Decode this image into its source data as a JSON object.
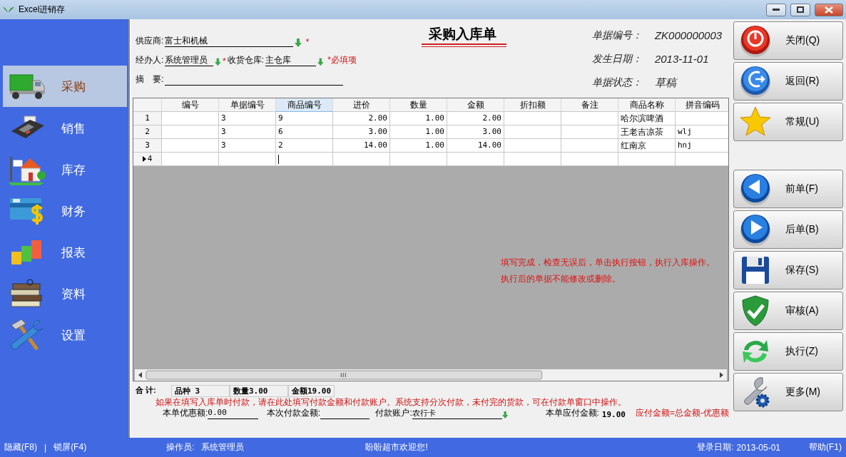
{
  "window": {
    "title": "Excel进销存"
  },
  "sidebar": {
    "items": [
      {
        "label": "采购",
        "selected": true,
        "kind": "truck"
      },
      {
        "label": "销售",
        "selected": false,
        "kind": "terminal"
      },
      {
        "label": "库存",
        "selected": false,
        "kind": "house"
      },
      {
        "label": "财务",
        "selected": false,
        "kind": "card"
      },
      {
        "label": "报表",
        "selected": false,
        "kind": "blocks"
      },
      {
        "label": "资料",
        "selected": false,
        "kind": "books"
      },
      {
        "label": "设置",
        "selected": false,
        "kind": "tools"
      }
    ]
  },
  "header": {
    "title": "采购入库单",
    "supplier": {
      "label": "供应商:",
      "value": "富士和机械",
      "required_mark": "*"
    },
    "handler": {
      "label": "经办人:",
      "value": "系统管理员",
      "required_mark": "*"
    },
    "warehouse": {
      "label": "收货仓库:",
      "value": "主仓库",
      "required_note": "*必填项"
    },
    "summary": {
      "label": "摘　要:"
    },
    "info": [
      {
        "label": "单据编号：",
        "value": "ZK000000003"
      },
      {
        "label": "发生日期：",
        "value": "2013-11-01"
      },
      {
        "label": "单据状态：",
        "value": "草稿"
      }
    ]
  },
  "table": {
    "columns": [
      {
        "label": "编号",
        "selected": false,
        "kind": "text"
      },
      {
        "label": "单据编号",
        "selected": false,
        "kind": "text"
      },
      {
        "label": "商品编号",
        "selected": true,
        "kind": "text"
      },
      {
        "label": "进价",
        "selected": false,
        "kind": "number"
      },
      {
        "label": "数量",
        "selected": false,
        "kind": "number"
      },
      {
        "label": "金额",
        "selected": false,
        "kind": "number"
      },
      {
        "label": "折扣额",
        "selected": false,
        "kind": "number"
      },
      {
        "label": "备注",
        "selected": false,
        "kind": "text"
      },
      {
        "label": "商品名称",
        "selected": false,
        "kind": "text"
      },
      {
        "label": "拼音编码",
        "selected": false,
        "kind": "text"
      }
    ],
    "rows": [
      {
        "number": "1",
        "current": false,
        "cells": [
          null,
          "3",
          "9",
          "2.00",
          "1.00",
          "2.00",
          null,
          null,
          "哈尔滨啤酒",
          null
        ]
      },
      {
        "number": "2",
        "current": false,
        "cells": [
          null,
          "3",
          "6",
          "3.00",
          "1.00",
          "3.00",
          null,
          null,
          "王老吉凉茶",
          "wlj"
        ]
      },
      {
        "number": "3",
        "current": false,
        "cells": [
          null,
          "3",
          "2",
          "14.00",
          "1.00",
          "14.00",
          null,
          null,
          "红南京",
          "hnj"
        ]
      },
      {
        "number": "4",
        "current": true
      }
    ]
  },
  "instructions": [
    "填写完成，检查无误后，单击执行按钮，执行入库操作。",
    "执行后的单据不能修改或删除。"
  ],
  "totals": {
    "label": "合 计:",
    "items": [
      "品种 3",
      "数量3.00",
      "金额19.00"
    ]
  },
  "payment_note": "如果在填写入库单时付款，请在此处填写付款金额和付款账户。系统支持分次付款，未付完的货款，可在付款单窗口中操作。",
  "payment": {
    "discount": {
      "label": "本单优惠额:",
      "value": "0.00"
    },
    "paid": {
      "label": "本次付款金额:"
    },
    "account": {
      "label": "付款账户:",
      "value": "农行卡"
    },
    "payable": {
      "label": "本单应付金额:",
      "value": "19.00"
    },
    "formula": "应付金额=总金额-优惠额"
  },
  "actions": {
    "primary": [
      {
        "label": "关闭(Q)",
        "kind": "power"
      },
      {
        "label": "返回(R)",
        "kind": "back"
      },
      {
        "label": "常规(U)",
        "kind": "star"
      }
    ],
    "navigation": [
      {
        "label": "前单(F)",
        "kind": "left"
      },
      {
        "label": "后单(B)",
        "kind": "right"
      },
      {
        "label": "保存(S)",
        "kind": "save"
      },
      {
        "label": "审核(A)",
        "kind": "shield"
      },
      {
        "label": "执行(Z)",
        "kind": "refresh"
      },
      {
        "label": "更多(M)",
        "kind": "wrench"
      }
    ]
  },
  "status_bar": {
    "hide": "隐藏(F8)",
    "separator": "|",
    "lock": "锁屏(F4)",
    "operator_label": "操作员:",
    "operator": "系统管理员",
    "welcome": "盼盼超市欢迎您!",
    "login_label": "登录日期:",
    "login_date": "2013-05-01",
    "help": "帮助(F1)"
  }
}
